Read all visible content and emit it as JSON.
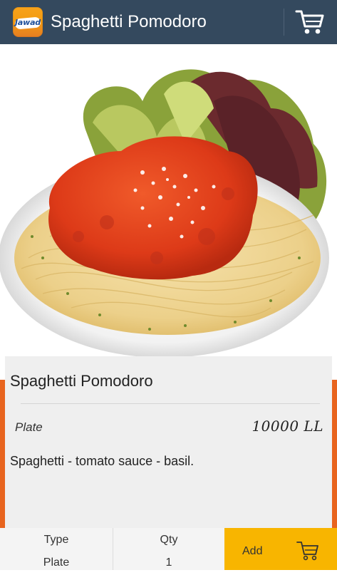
{
  "appbar": {
    "logo_text": "Jawad",
    "title": "Spaghetti Pomodoro",
    "cart_icon": "cart-icon"
  },
  "hero": {
    "image_subject": "spaghetti-pomodoro-plate",
    "colors": {
      "sauce": "#e0401e",
      "pasta": "#f1d89a",
      "lettuce": "#9fb84a"
    }
  },
  "product": {
    "name": "Spaghetti Pomodoro",
    "type": "Plate",
    "price": "10000 LL",
    "description": "Spaghetti - tomato sauce - basil."
  },
  "order_bar": {
    "type_label": "Type",
    "type_value": "Plate",
    "qty_label": "Qty",
    "qty_value": "1",
    "add_label": "Add",
    "add_icon": "cart-icon"
  },
  "colors": {
    "appbar": "#34495e",
    "accent_orange": "#e8641e",
    "add_button": "#f8b500",
    "card_bg": "#efefef"
  }
}
